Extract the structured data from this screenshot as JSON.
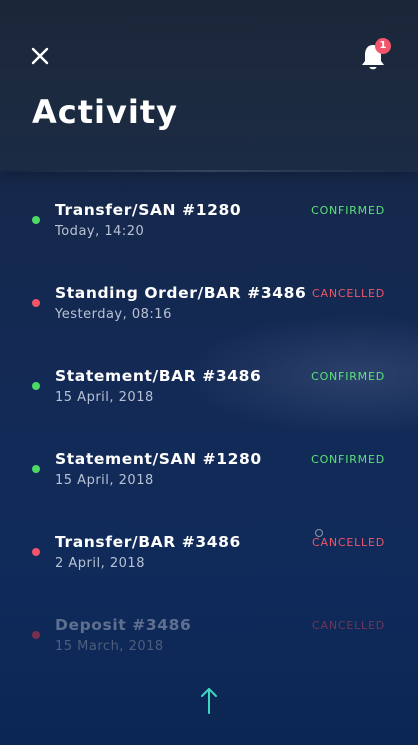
{
  "header": {
    "title": "Activity",
    "notification_count": "1",
    "close_icon": "close-icon",
    "bell_icon": "bell-icon"
  },
  "colors": {
    "confirmed": "#5be37a",
    "cancelled": "#f0556a",
    "cancelled_faded": "#7a3a55",
    "dot_green": "#4cd964",
    "dot_red": "#f0556a",
    "arrow": "#3fd6c2"
  },
  "activities": [
    {
      "title": "Transfer/SAN #1280",
      "date": "Today, 14:20",
      "status": "CONFIRMED",
      "state": "confirmed"
    },
    {
      "title": "Standing Order/BAR #3486",
      "date": "Yesterday, 08:16",
      "status": "CANCELLED",
      "state": "cancelled"
    },
    {
      "title": "Statement/BAR #3486",
      "date": "15 April, 2018",
      "status": "CONFIRMED",
      "state": "confirmed"
    },
    {
      "title": "Statement/SAN #1280",
      "date": "15 April, 2018",
      "status": "CONFIRMED",
      "state": "confirmed"
    },
    {
      "title": "Transfer/BAR #3486",
      "date": "2 April, 2018",
      "status": "CANCELLED",
      "state": "cancelled"
    },
    {
      "title": "Deposit #3486",
      "date": "15 March, 2018",
      "status": "CANCELLED",
      "state": "cancelled-faded"
    }
  ],
  "footer": {
    "scroll_top_icon": "arrow-up-icon"
  }
}
